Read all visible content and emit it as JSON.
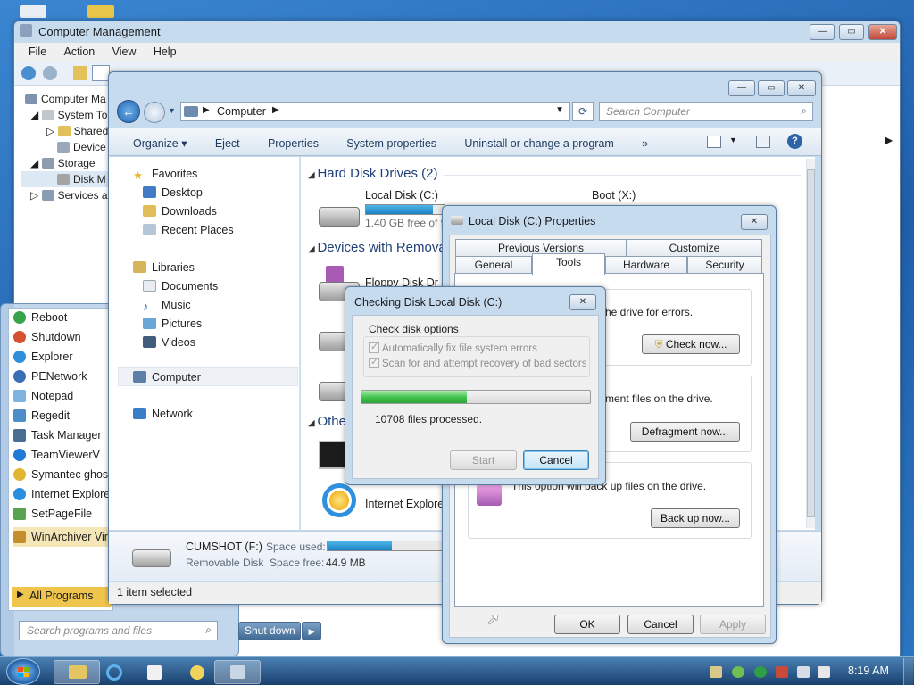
{
  "taskbar": {
    "clock": "8:19 AM"
  },
  "computer_management": {
    "title": "Computer Management",
    "menu": [
      "File",
      "Action",
      "View",
      "Help"
    ],
    "tree": [
      "Computer Ma",
      "System To",
      "Shared",
      "Device",
      "Storage",
      "Disk M",
      "Services an"
    ]
  },
  "explorer": {
    "breadcrumb": "Computer",
    "search_placeholder": "Search Computer",
    "commands": [
      "Organize",
      "Eject",
      "Properties",
      "System properties",
      "Uninstall or change a program"
    ],
    "more": "»",
    "nav": {
      "favorites": "Favorites",
      "desktop": "Desktop",
      "downloads": "Downloads",
      "recent_places": "Recent Places",
      "libraries": "Libraries",
      "documents": "Documents",
      "music": "Music",
      "pictures": "Pictures",
      "videos": "Videos",
      "computer": "Computer",
      "network": "Network"
    },
    "groups": {
      "hard_disk": "Hard Disk Drives (2)",
      "removable": "Devices with Remova",
      "other": "Othe"
    },
    "drives": {
      "local_c": {
        "name": "Local Disk (C:)",
        "free": "1.40 GB free of 9",
        "used_fraction": 0.85
      },
      "boot_x": {
        "name": "Boot (X:)"
      },
      "floppy": {
        "name": "Floppy Disk Dr"
      },
      "ie": {
        "name": "Internet Explorer"
      }
    },
    "details": {
      "name": "CUMSHOT (F:)",
      "type": "Removable Disk",
      "space_used_label": "Space used:",
      "space_free_label": "Space free:",
      "space_free": "44.9 MB",
      "used_fraction": 0.52
    },
    "status": "1 item selected"
  },
  "properties": {
    "title": "Local Disk (C:) Properties",
    "tabs_back": [
      "Previous Versions",
      "Customize"
    ],
    "tabs_front": [
      "General",
      "Tools",
      "Hardware",
      "Security"
    ],
    "error_text": "he drive for errors.",
    "check_now": "Check now...",
    "defrag_text": "ment files on the drive.",
    "defrag_now": "Defragment now...",
    "backup_text": "This option will back up files on the drive.",
    "backup_now": "Back up now...",
    "ok": "OK",
    "cancel": "Cancel",
    "apply": "Apply"
  },
  "check_disk": {
    "title": "Checking Disk Local Disk (C:)",
    "options_label": "Check disk options",
    "option1": "Automatically fix file system errors",
    "option2": "Scan for and attempt recovery of bad sectors",
    "progress_fraction": 0.46,
    "status": "10708 files processed.",
    "start": "Start",
    "cancel": "Cancel"
  },
  "start_menu": {
    "items": [
      "Reboot",
      "Shutdown",
      "Explorer",
      "PENetwork",
      "Notepad",
      "Regedit",
      "Task Manager",
      "TeamViewerV",
      "Symantec ghost",
      "Internet Explorer",
      "SetPageFile",
      "WinArchiver Virt"
    ],
    "all_programs": "All Programs",
    "search_placeholder": "Search programs and files",
    "shutdown": "Shut down"
  },
  "colors": {
    "accent": "#1c83c4",
    "progress_green": "#3ec24b",
    "desktop": "#2b6fb8"
  }
}
